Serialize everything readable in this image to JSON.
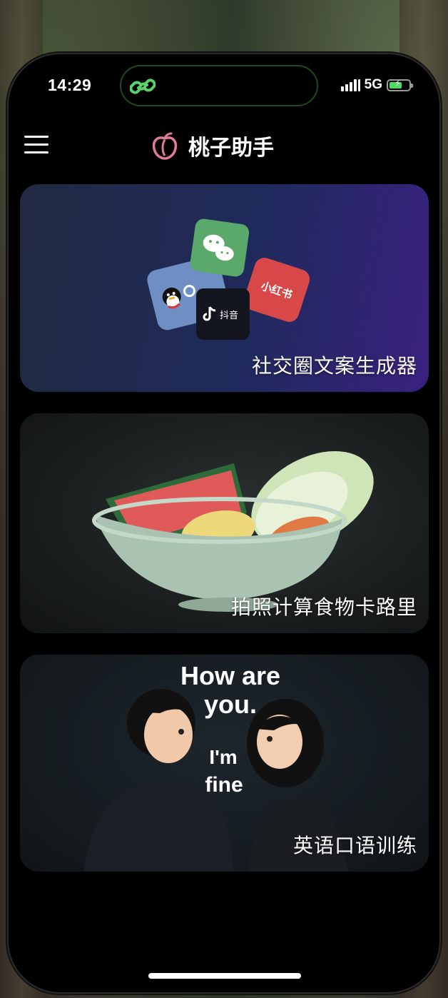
{
  "status_bar": {
    "time": "14:29",
    "network": "5G"
  },
  "header": {
    "title": "桃子助手",
    "logo_icon": "peach-icon",
    "menu_icon": "hamburger-menu-icon"
  },
  "cards": [
    {
      "id": "social",
      "label": "社交圈文案生成器"
    },
    {
      "id": "food",
      "label": "拍照计算食物卡路里"
    },
    {
      "id": "english",
      "label": "英语口语训练"
    }
  ],
  "social_art": {
    "douyin_label": "抖音",
    "xiaohongshu_label": "小红书"
  },
  "english_art": {
    "line1": "How are",
    "line2": "you.",
    "line3": "I'm",
    "line4": "fine"
  },
  "colors": {
    "background": "#000000",
    "peach": "#e07a95",
    "wechat_green": "#5aa86a",
    "xiaohongshu_red": "#d94848",
    "qq_blue": "#6f8fc4"
  }
}
